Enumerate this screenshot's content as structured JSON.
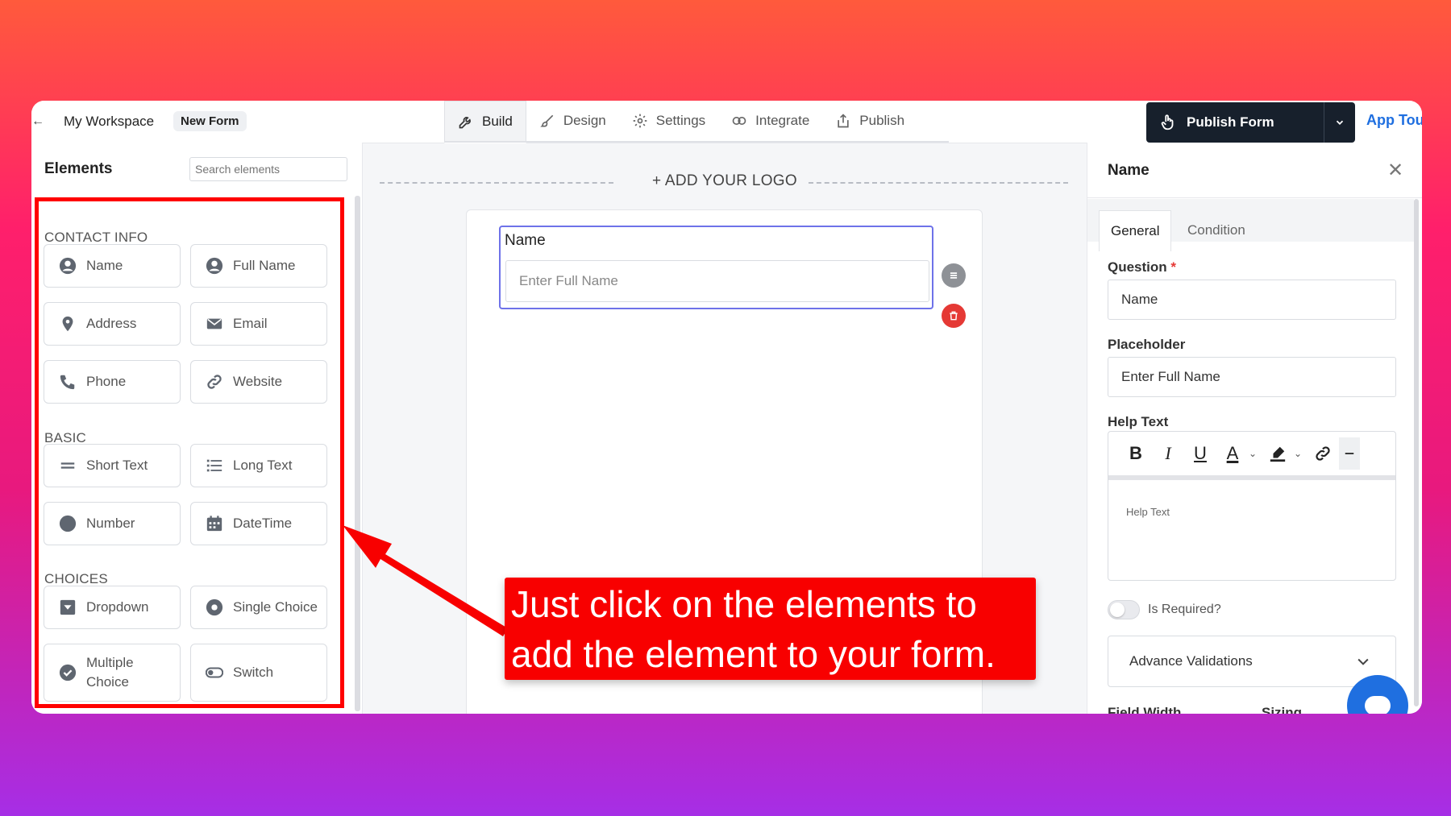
{
  "topbar": {
    "back_icon": "arrow-left-icon",
    "workspace": "My Workspace",
    "form_name": "New Form",
    "tabs": [
      {
        "label": "Build",
        "icon": "wrench-icon",
        "active": true
      },
      {
        "label": "Design",
        "icon": "brush-icon"
      },
      {
        "label": "Settings",
        "icon": "gear-icon"
      },
      {
        "label": "Integrate",
        "icon": "link-icon"
      },
      {
        "label": "Publish",
        "icon": "share-icon"
      }
    ],
    "publish_button": "Publish Form",
    "app_tour": "App Tour"
  },
  "elements_panel": {
    "title": "Elements",
    "search_placeholder": "Search elements",
    "sections": [
      {
        "heading": "CONTACT INFO",
        "items": [
          "Name",
          "Full Name",
          "Address",
          "Email",
          "Phone",
          "Website"
        ]
      },
      {
        "heading": "BASIC",
        "items": [
          "Short Text",
          "Long Text",
          "Number",
          "DateTime"
        ]
      },
      {
        "heading": "CHOICES",
        "items": [
          "Dropdown",
          "Single Choice",
          "Multiple Choice",
          "Switch"
        ]
      }
    ],
    "multiple_line1": "Multiple",
    "multiple_line2": "Choice"
  },
  "canvas": {
    "logo_prompt": "+ ADD YOUR LOGO",
    "field_label": "Name",
    "field_placeholder": "Enter Full Name"
  },
  "properties_panel": {
    "title": "Name",
    "tabs": [
      "General",
      "Condition"
    ],
    "question_label": "Question",
    "required_mark": "*",
    "question_value": "Name",
    "placeholder_label": "Placeholder",
    "placeholder_value": "Enter Full Name",
    "help_label": "Help Text",
    "toolbar": {
      "bold": "B",
      "italic": "I",
      "underline": "U",
      "color": "A"
    },
    "help_text_placeholder": "Help Text",
    "required_toggle": "Is Required?",
    "advanced": "Advance Validations",
    "cut_label1": "Field Width",
    "cut_label2": "Sizing"
  },
  "annotation": {
    "line1": "Just click on the elements to",
    "line2": "add the element to your form."
  },
  "colors": {
    "accent_blue": "#1f6fe0",
    "publish_dark": "#17202c",
    "highlight_red": "#ff0000",
    "field_focus": "#6e72e9"
  }
}
